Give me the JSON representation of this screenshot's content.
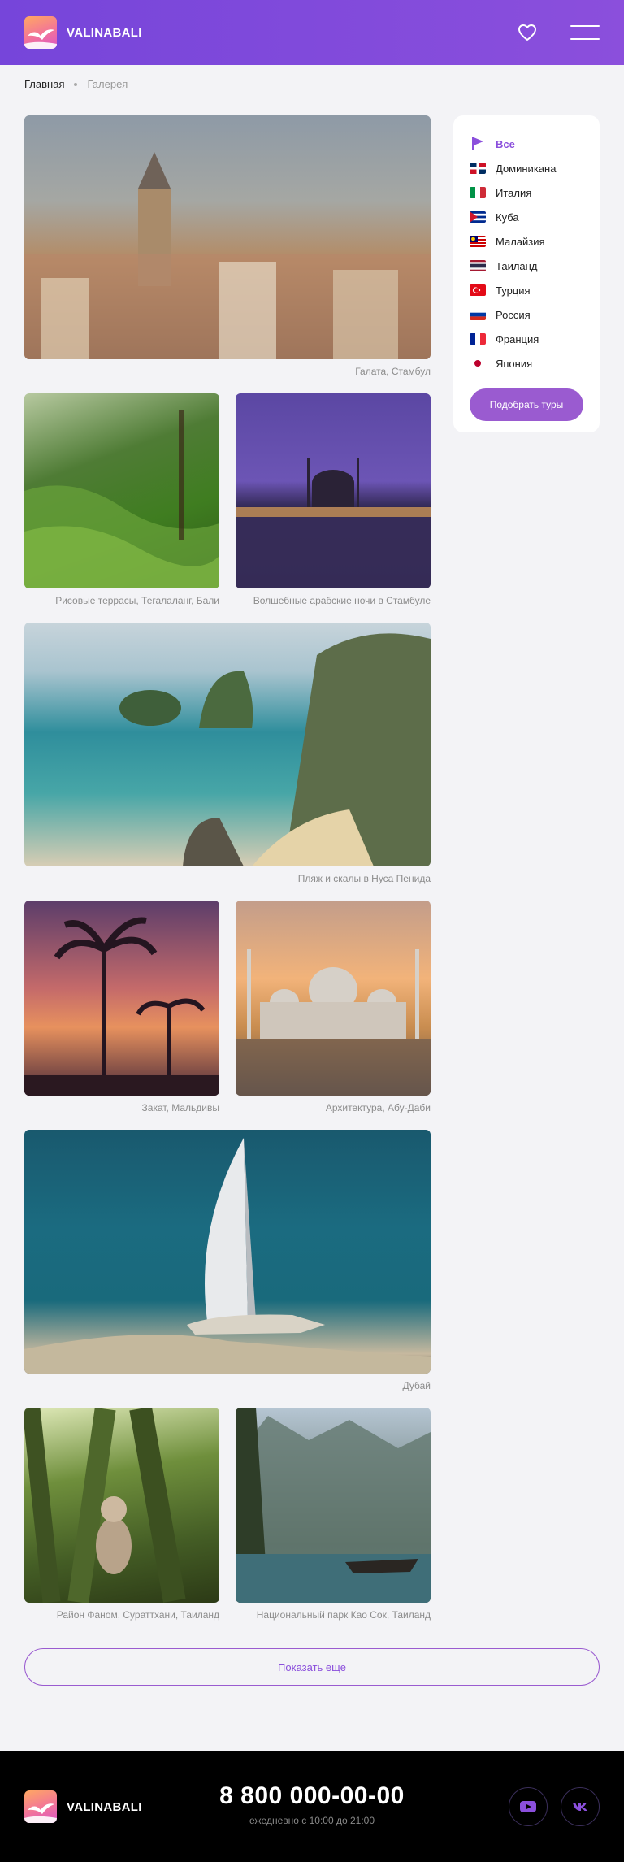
{
  "header": {
    "logo_text": "VALINABALI"
  },
  "breadcrumb": {
    "home": "Главная",
    "current": "Галерея"
  },
  "gallery": [
    {
      "caption": "Галата, Стамбул"
    },
    {
      "caption": "Рисовые террасы, Тегалаланг, Бали"
    },
    {
      "caption": "Волшебные арабские ночи в Стамбуле"
    },
    {
      "caption": "Пляж и скалы в Нуса Пенида"
    },
    {
      "caption": "Закат, Мальдивы"
    },
    {
      "caption": "Архитектура, Абу-Даби"
    },
    {
      "caption": "Дубай"
    },
    {
      "caption": "Район Фаном, Сураттхани, Таиланд"
    },
    {
      "caption": "Национальный парк Као Сок, Таиланд"
    }
  ],
  "sidebar": {
    "items": [
      {
        "label": "Все",
        "icon": "flag-icon"
      },
      {
        "label": "Доминикана",
        "icon": "dominican-flag-icon"
      },
      {
        "label": "Италия",
        "icon": "italy-flag-icon"
      },
      {
        "label": "Куба",
        "icon": "cuba-flag-icon"
      },
      {
        "label": "Малайзия",
        "icon": "malaysia-flag-icon"
      },
      {
        "label": "Таиланд",
        "icon": "thailand-flag-icon"
      },
      {
        "label": "Турция",
        "icon": "turkey-flag-icon"
      },
      {
        "label": "Россия",
        "icon": "russia-flag-icon"
      },
      {
        "label": "Франция",
        "icon": "france-flag-icon"
      },
      {
        "label": "Япония",
        "icon": "japan-flag-icon"
      }
    ],
    "button_label": "Подобрать туры"
  },
  "show_more_label": "Показать еще",
  "footer": {
    "logo_text": "VALINABALI",
    "phone": "8 800 000-00-00",
    "hours": "ежедневно с 10:00 до 21:00"
  },
  "colors": {
    "accent": "#8b4fdc",
    "button": "#9a5bd0",
    "header_start": "#7645da",
    "footer_bg": "#000000"
  }
}
